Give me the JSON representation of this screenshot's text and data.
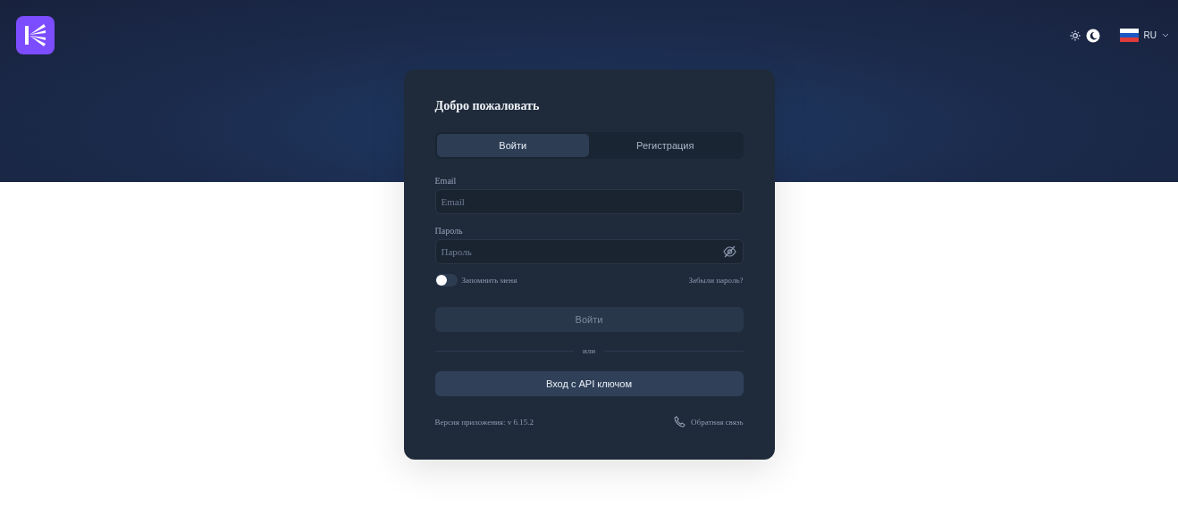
{
  "header": {
    "theme_toggle": [
      {
        "kind": "sun",
        "selected": false
      },
      {
        "kind": "moon",
        "selected": true
      }
    ],
    "language": {
      "code": "RU"
    }
  },
  "card": {
    "title": "Добро пожаловать",
    "tabs": [
      {
        "label": "Войти",
        "selected": true
      },
      {
        "label": "Регистрация",
        "selected": false
      }
    ],
    "fields": [
      {
        "label": "Email",
        "placeholder": "Email",
        "kind": "text"
      },
      {
        "label": "Пароль",
        "placeholder": "Пароль",
        "kind": "password"
      }
    ],
    "remember": {
      "label": "Запомнить меня",
      "checked": false
    },
    "forgot_link": "Забыли пароль?",
    "login_button": {
      "label": "Войти",
      "disabled": true
    },
    "divider": "или",
    "api_button": "Вход с API ключом",
    "version": "Версия приложения: v 6.15.2",
    "feedback_link": "Обратная связь"
  }
}
